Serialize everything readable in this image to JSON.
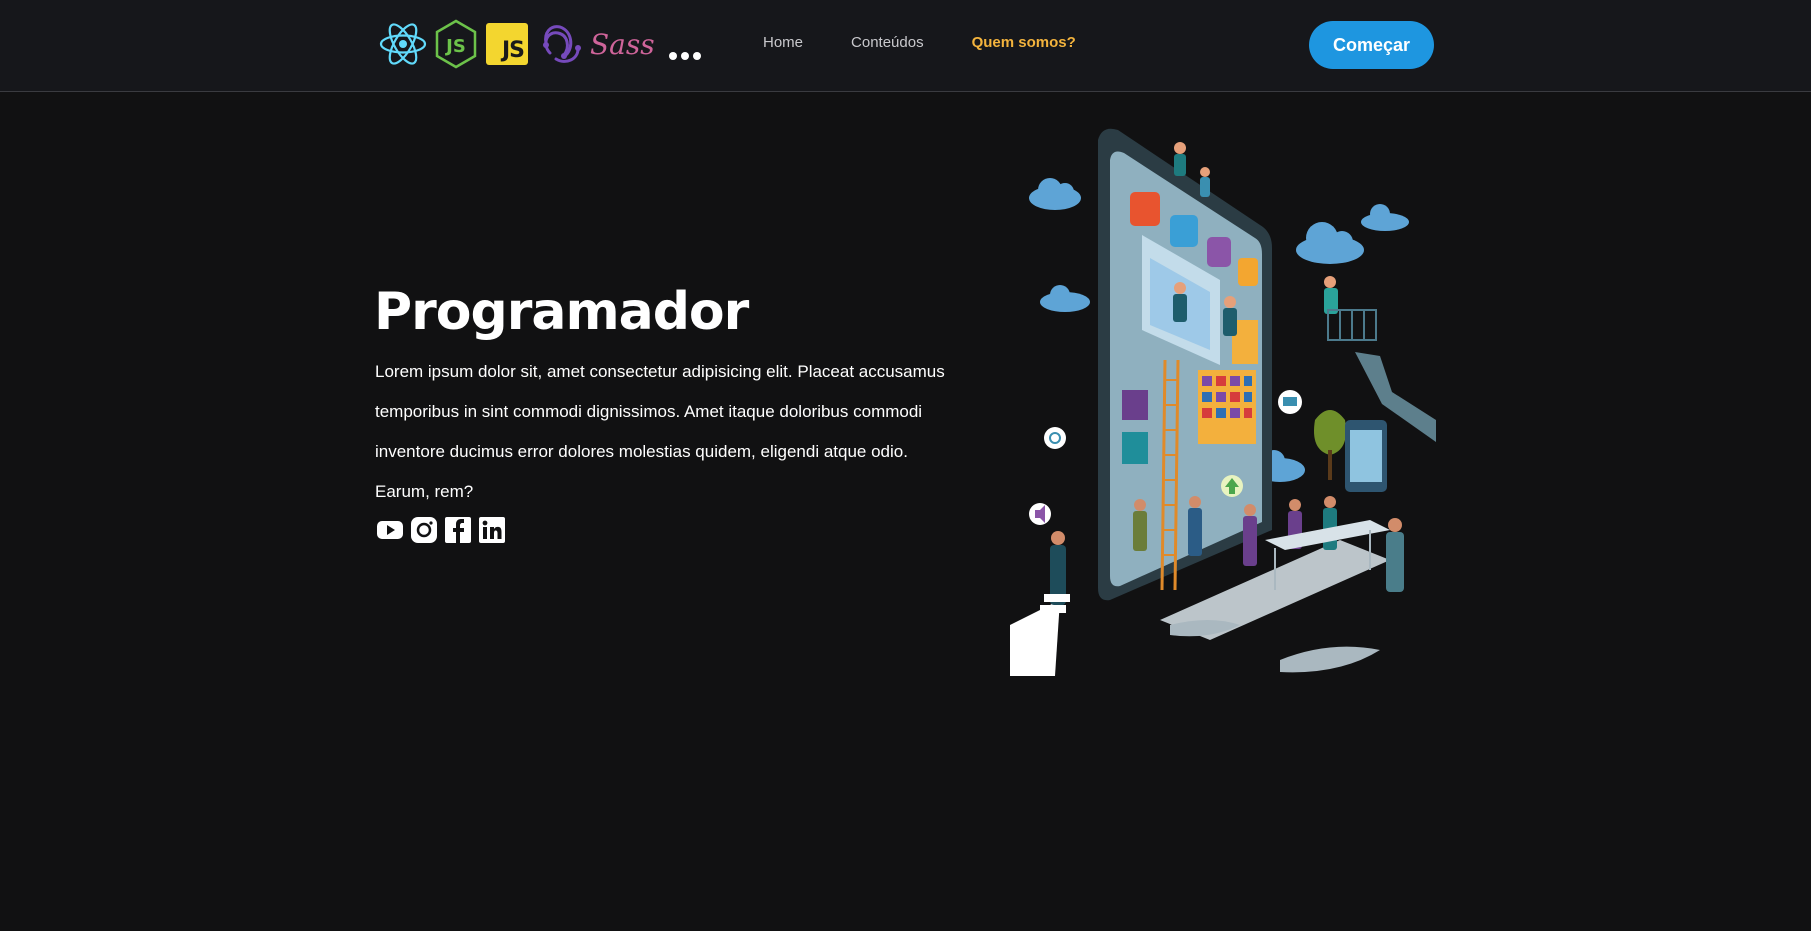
{
  "header": {
    "tech_logos": [
      {
        "icon": "react-logo-icon"
      },
      {
        "icon": "nodejs-logo-icon"
      },
      {
        "icon": "javascript-logo-icon",
        "label": "JS"
      },
      {
        "icon": "redux-logo-icon"
      },
      {
        "icon": "sass-logo-icon",
        "label": "Sass"
      },
      {
        "icon": "more-dots-icon"
      }
    ],
    "nav": {
      "home": "Home",
      "conteudos": "Conteúdos",
      "quem_somos": "Quem somos?"
    },
    "active_nav_color": "#f3b33d",
    "cta_label": "Começar",
    "cta_color": "#1e96e0"
  },
  "hero": {
    "title": "Programador",
    "text": "Lorem ipsum dolor sit, amet consectetur adipisicing elit. Placeat accusamus temporibus in sint commodi dignissimos. Amet itaque doloribus commodi inventore ducimus error dolores molestias quidem, eligendi atque odio. Earum, rem?",
    "socials": [
      "youtube-icon",
      "instagram-icon",
      "facebook-icon",
      "linkedin-icon"
    ]
  },
  "colors": {
    "background": "#111112",
    "header_background": "#16171b"
  }
}
